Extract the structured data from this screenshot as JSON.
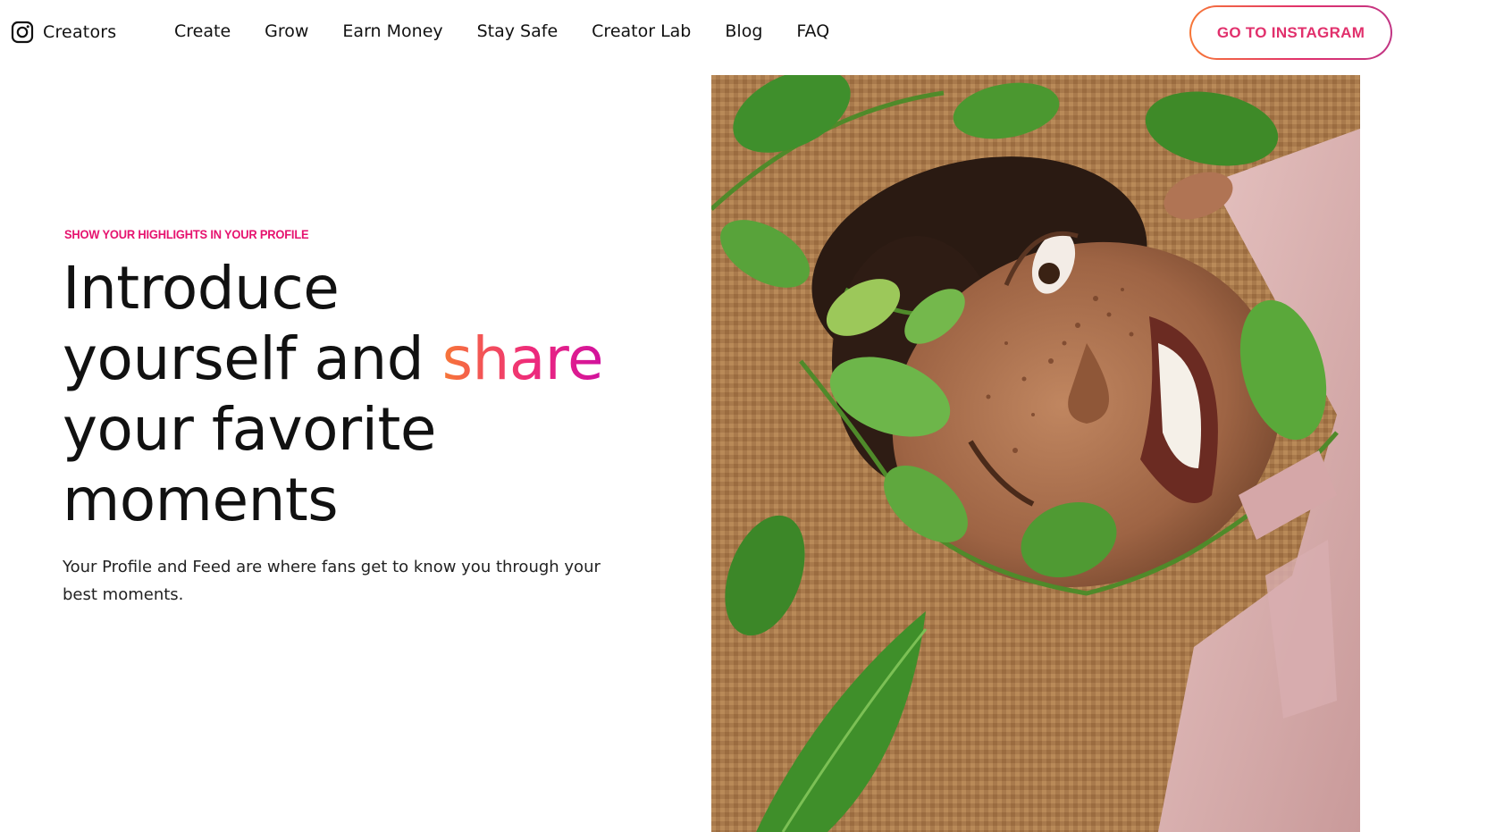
{
  "header": {
    "brand_label": "Creators",
    "brand_icon": "instagram-icon",
    "nav": [
      "Create",
      "Grow",
      "Earn Money",
      "Stay Safe",
      "Creator Lab",
      "Blog",
      "FAQ"
    ],
    "cta_label": "GO TO INSTAGRAM"
  },
  "hero": {
    "eyebrow": "SHOW YOUR HIGHLIGHTS IN YOUR PROFILE",
    "headline_line1": "Introduce",
    "headline_line2_pre": "yourself and ",
    "headline_accent": "share",
    "headline_line3": "your favorite",
    "headline_line4": "moments",
    "subtext": "Your Profile and Feed are where fans get to know you through your best moments."
  },
  "colors": {
    "accent_pink": "#e6136f",
    "gradient_start": "#f77737",
    "gradient_end": "#d1119e",
    "text": "#111111"
  }
}
